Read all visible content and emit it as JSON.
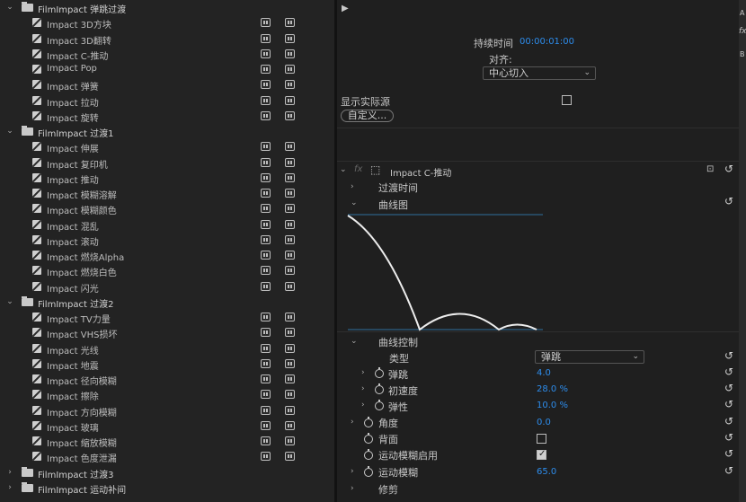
{
  "effects_list": [
    {
      "kind": "folder",
      "label": "FilmImpact 弹跳过渡",
      "expanded": true
    },
    {
      "kind": "effect",
      "label": "Impact 3D方块"
    },
    {
      "kind": "effect",
      "label": "Impact 3D翻转"
    },
    {
      "kind": "effect",
      "label": "Impact C-推动"
    },
    {
      "kind": "effect",
      "label": "Impact Pop"
    },
    {
      "kind": "effect",
      "label": "Impact 弹簧"
    },
    {
      "kind": "effect",
      "label": "Impact 拉动"
    },
    {
      "kind": "effect",
      "label": "Impact 旋转"
    },
    {
      "kind": "folder",
      "label": "FilmImpact 过渡1",
      "expanded": true
    },
    {
      "kind": "effect",
      "label": "Impact 伸展"
    },
    {
      "kind": "effect",
      "label": "Impact 复印机"
    },
    {
      "kind": "effect",
      "label": "Impact 推动"
    },
    {
      "kind": "effect",
      "label": "Impact 模糊溶解"
    },
    {
      "kind": "effect",
      "label": "Impact 模糊颜色"
    },
    {
      "kind": "effect",
      "label": "Impact 混乱"
    },
    {
      "kind": "effect",
      "label": "Impact 滚动"
    },
    {
      "kind": "effect",
      "label": "Impact 燃烧Alpha"
    },
    {
      "kind": "effect",
      "label": "Impact 燃烧白色"
    },
    {
      "kind": "effect",
      "label": "Impact 闪光"
    },
    {
      "kind": "folder",
      "label": "FilmImpact 过渡2",
      "expanded": true
    },
    {
      "kind": "effect",
      "label": "Impact TV力量"
    },
    {
      "kind": "effect",
      "label": "Impact VHS损坏"
    },
    {
      "kind": "effect",
      "label": "Impact 光线"
    },
    {
      "kind": "effect",
      "label": "Impact 地震"
    },
    {
      "kind": "effect",
      "label": "Impact 径向模糊"
    },
    {
      "kind": "effect",
      "label": "Impact 擦除"
    },
    {
      "kind": "effect",
      "label": "Impact 方向模糊"
    },
    {
      "kind": "effect",
      "label": "Impact 玻璃"
    },
    {
      "kind": "effect",
      "label": "Impact 缩放模糊"
    },
    {
      "kind": "effect",
      "label": "Impact 色度泄漏"
    },
    {
      "kind": "folder",
      "label": "FilmImpact 过渡3",
      "expanded": false
    },
    {
      "kind": "folder",
      "label": "FilmImpact 运动补间",
      "expanded": false
    }
  ],
  "controls": {
    "play_icon": "play-icon",
    "duration_label": "持续时间",
    "duration_value": "00:00:01:00",
    "align_label": "对齐:",
    "align_value": "中心切入",
    "show_source_label": "显示实际源",
    "custom_button": "自定义...",
    "side_labels": [
      "A",
      "fx",
      "B"
    ]
  },
  "effect_panel": {
    "fx_label": "fx",
    "effect_name": "Impact C-推动",
    "transition_time_label": "过渡时间",
    "curve_label": "曲线图",
    "curve_control_label": "曲线控制",
    "type_label": "类型",
    "type_value": "弹跳",
    "bounce_label": "弹跳",
    "bounce_value": "4.0",
    "initial_speed_label": "初速度",
    "initial_speed_value": "28.0 %",
    "elasticity_label": "弹性",
    "elasticity_value": "10.0 %",
    "angle_label": "角度",
    "angle_value": "0.0",
    "back_label": "背面",
    "motion_blur_enable_label": "运动模糊启用",
    "motion_blur_label": "运动模糊",
    "motion_blur_value": "65.0",
    "crop_label": "修剪"
  },
  "colors": {
    "accent_blue": "#2d8ceb",
    "curve_blue": "#2f6f9e",
    "curve_white": "#ededed"
  }
}
